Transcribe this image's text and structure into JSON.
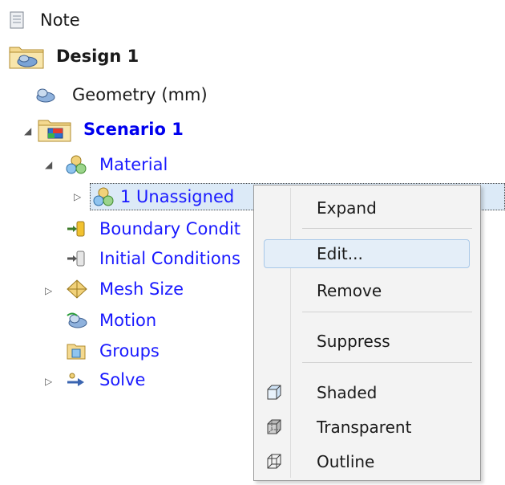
{
  "tree": {
    "note": "Note",
    "design": "Design 1",
    "geometry": "Geometry (mm)",
    "scenario": "Scenario 1",
    "material": "Material",
    "unassigned": "1 Unassigned",
    "boundary": "Boundary Condit",
    "initial": "Initial Conditions",
    "mesh": "Mesh Size",
    "motion": "Motion",
    "groups": "Groups",
    "solve": "Solve"
  },
  "menu": {
    "expand": "Expand",
    "edit": "Edit...",
    "remove": "Remove",
    "suppress": "Suppress",
    "shaded": "Shaded",
    "transparent": "Transparent",
    "outline": "Outline"
  },
  "colors": {
    "link_blue": "#1a1aff",
    "selection": "#dceaf7",
    "menu_bg": "#f3f3f3",
    "hover": "#e4eef8"
  }
}
